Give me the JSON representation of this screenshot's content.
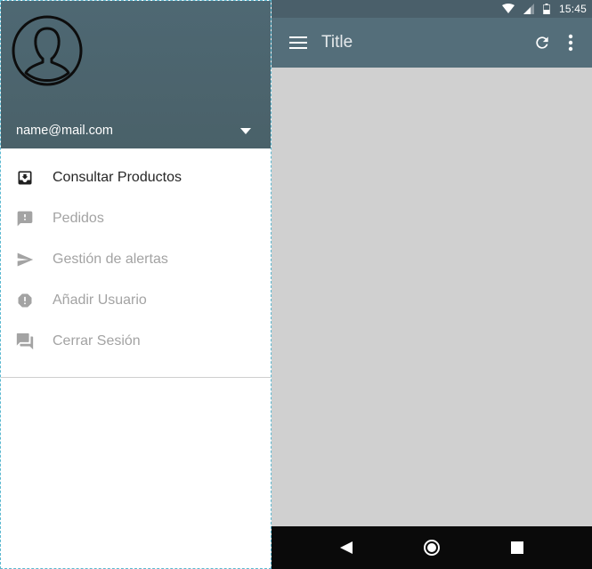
{
  "status_bar": {
    "time": "15:45",
    "icons": [
      "wifi-icon",
      "signal-icon",
      "battery-icon"
    ]
  },
  "toolbar": {
    "title": "Title",
    "menu_icon": "hamburger-menu-icon",
    "actions": [
      "refresh-icon",
      "more-vert-icon"
    ]
  },
  "drawer": {
    "account": {
      "email": "name@mail.com",
      "avatar_icon": "person-avatar-icon",
      "dropdown_icon": "arrow-drop-down-icon"
    },
    "items": [
      {
        "label": "Consultar Productos",
        "icon": "move-to-inbox-icon",
        "active": true
      },
      {
        "label": "Pedidos",
        "icon": "feedback-icon",
        "active": false
      },
      {
        "label": "Gestión de alertas",
        "icon": "send-icon",
        "active": false
      },
      {
        "label": "Añadir Usuario",
        "icon": "error-icon",
        "active": false
      },
      {
        "label": "Cerrar Sesión",
        "icon": "forum-icon",
        "active": false
      }
    ]
  },
  "navigation_bar": {
    "buttons": [
      "back-icon",
      "home-icon",
      "recents-icon"
    ]
  },
  "colors": {
    "primary": "#546e7a",
    "status_bar": "#4a5f6a",
    "content_background": "#d0d0d0",
    "active_text": "#262626",
    "inactive_text": "#a3a3a3"
  }
}
